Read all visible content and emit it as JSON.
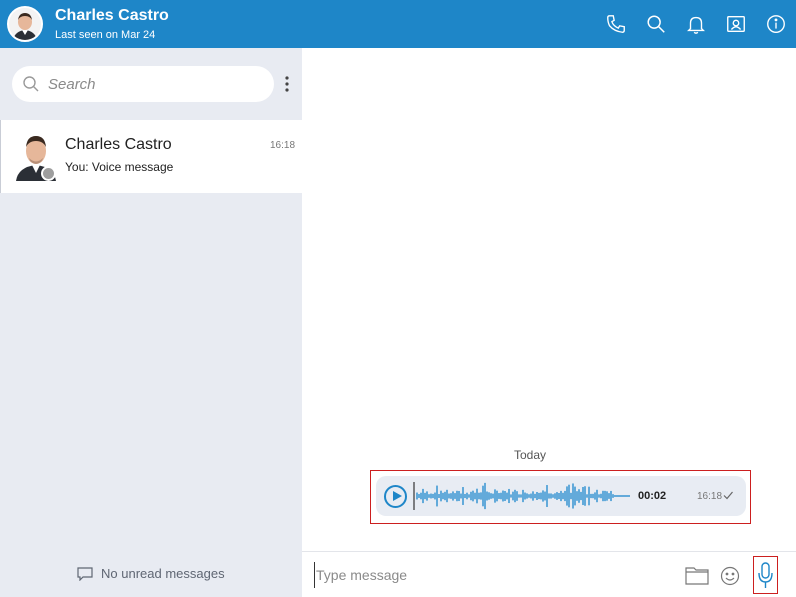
{
  "header": {
    "contact_name": "Charles Castro",
    "last_seen": "Last seen on Mar 24",
    "icons": [
      "phone-icon",
      "search-icon",
      "bell-icon",
      "contact-card-icon",
      "info-icon"
    ],
    "accent_color": "#1e86c8"
  },
  "sidebar": {
    "search_placeholder": "Search",
    "chats": [
      {
        "name": "Charles Castro",
        "preview": "You: Voice message",
        "time": "16:18",
        "status": "offline"
      }
    ],
    "empty_label": "No unread messages"
  },
  "conversation": {
    "day_label": "Today",
    "voice_message": {
      "duration": "00:02",
      "time": "16:18",
      "status": "sent",
      "progress": 0
    }
  },
  "composer": {
    "placeholder": "Type message",
    "icons": [
      "folder-icon",
      "emoji-icon",
      "microphone-icon"
    ]
  }
}
